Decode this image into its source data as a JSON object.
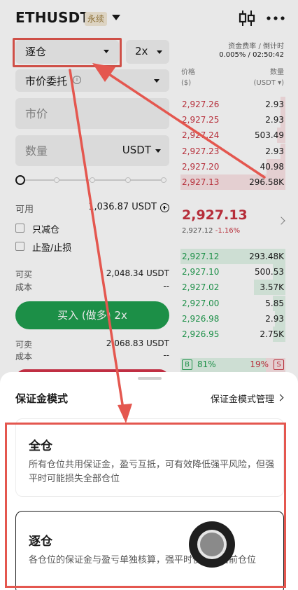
{
  "header": {
    "symbol": "ETHUSDT",
    "perp_badge": "永续"
  },
  "trade": {
    "margin_mode": "逐仓",
    "leverage": "2x",
    "order_type": "市价委托",
    "info_glyph": "i",
    "price_placeholder": "市价",
    "qty_placeholder": "数量",
    "qty_unit": "USDT",
    "slider_level_percent": 0,
    "available_label": "可用",
    "available_value": "1,036.87 USDT",
    "reduce_only": "只减仓",
    "tp_sl": "止盈/止损",
    "can_buy_label": "可买",
    "can_buy_value": "2,048.34 USDT",
    "cost_label_1": "成本",
    "cost_value_1": "--",
    "buy_button": "买入 (做多) 2x",
    "can_sell_label": "可卖",
    "can_sell_value": "2,068.83 USDT",
    "cost_label_2": "成本",
    "cost_value_2": "--"
  },
  "orderbook": {
    "funding_label": "资金费率 / 倒计时",
    "funding_value": "0.005% / 02:50:42",
    "col_price": "价格",
    "col_price_unit": "($)",
    "col_qty": "数量",
    "col_qty_unit": "(USDT ▾)",
    "asks": [
      {
        "price": "2,927.26",
        "qty": "2.93",
        "depth": 0.05
      },
      {
        "price": "2,927.25",
        "qty": "2.93",
        "depth": 0.05
      },
      {
        "price": "2,927.24",
        "qty": "503.49",
        "depth": 0.08
      },
      {
        "price": "2,927.23",
        "qty": "2.93",
        "depth": 0.05
      },
      {
        "price": "2,927.20",
        "qty": "40.98",
        "depth": 0.18
      },
      {
        "price": "2,927.13",
        "qty": "296.58K",
        "depth": 1.0
      }
    ],
    "last_price": "2,927.13",
    "mark_price": "2,927.12",
    "change": "-1.16%",
    "bids": [
      {
        "price": "2,927.12",
        "qty": "293.48K",
        "depth": 1.0
      },
      {
        "price": "2,927.10",
        "qty": "500.53",
        "depth": 0.12
      },
      {
        "price": "2,927.02",
        "qty": "3.57K",
        "depth": 0.3
      },
      {
        "price": "2,927.00",
        "qty": "5.85",
        "depth": 0.12
      },
      {
        "price": "2,926.98",
        "qty": "2.93",
        "depth": 0.1
      },
      {
        "price": "2,926.95",
        "qty": "2.75K",
        "depth": 0.12
      }
    ],
    "buy_badge": "B",
    "buy_pct": "81%",
    "sell_pct": "19%",
    "sell_badge": "S",
    "buy_ratio": 0.81
  },
  "sheet": {
    "title": "保证金模式",
    "manage_link": "保证金模式管理",
    "options": [
      {
        "name": "全仓",
        "desc": "所有仓位共用保证金，盈亏互抵，可有效降低强平风险，但强平时可能损失全部仓位"
      },
      {
        "name": "逐仓",
        "desc": "各仓位的保证金与盈亏单独核算，强平时仅损失当前仓位"
      }
    ]
  },
  "colors": {
    "ask": "#c8323f",
    "bid": "#1f9e4f",
    "annotation": "#e4574f"
  }
}
